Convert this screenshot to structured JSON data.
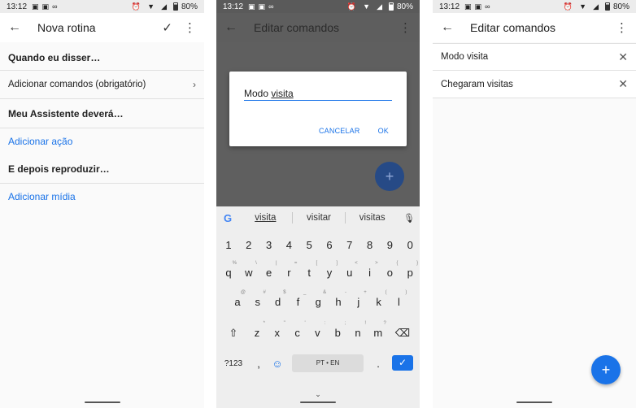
{
  "status": {
    "time": "13:12",
    "battery": "80%"
  },
  "screen1": {
    "title": "Nova rotina",
    "when_heading": "Quando eu disser…",
    "add_commands": "Adicionar comandos (obrigatório)",
    "assistant_heading": "Meu Assistente deverá…",
    "add_action": "Adicionar ação",
    "then_heading": "E depois reproduzir…",
    "add_media": "Adicionar mídia"
  },
  "screen2": {
    "title": "Editar comandos",
    "dialog": {
      "input_prefix": "Modo ",
      "input_word": "visita",
      "cancel_label": "CANCELAR",
      "ok_label": "OK"
    },
    "suggestions": [
      "visita",
      "visitar",
      "visitas"
    ],
    "keyboard": {
      "row_numbers": [
        "1",
        "2",
        "3",
        "4",
        "5",
        "6",
        "7",
        "8",
        "9",
        "0"
      ],
      "row_q": [
        "q",
        "w",
        "e",
        "r",
        "t",
        "y",
        "u",
        "i",
        "o",
        "p"
      ],
      "row_q_alt": [
        "%",
        "\\",
        "|",
        "=",
        "[",
        "]",
        "<",
        ">",
        "{",
        "}"
      ],
      "row_a": [
        "a",
        "s",
        "d",
        "f",
        "g",
        "h",
        "j",
        "k",
        "l"
      ],
      "row_a_alt": [
        "@",
        "#",
        "$",
        "_",
        "&",
        "-",
        "+",
        "(",
        ")"
      ],
      "row_z": [
        "z",
        "x",
        "c",
        "v",
        "b",
        "n",
        "m"
      ],
      "row_z_alt": [
        "*",
        "\"",
        "'",
        ":",
        ";",
        "!",
        "?"
      ],
      "symbols_label": "?123",
      "comma": ",",
      "space_label": "PT • EN",
      "period": "."
    }
  },
  "screen3": {
    "title": "Editar comandos",
    "commands": [
      "Modo visita",
      "Chegaram visitas"
    ]
  }
}
